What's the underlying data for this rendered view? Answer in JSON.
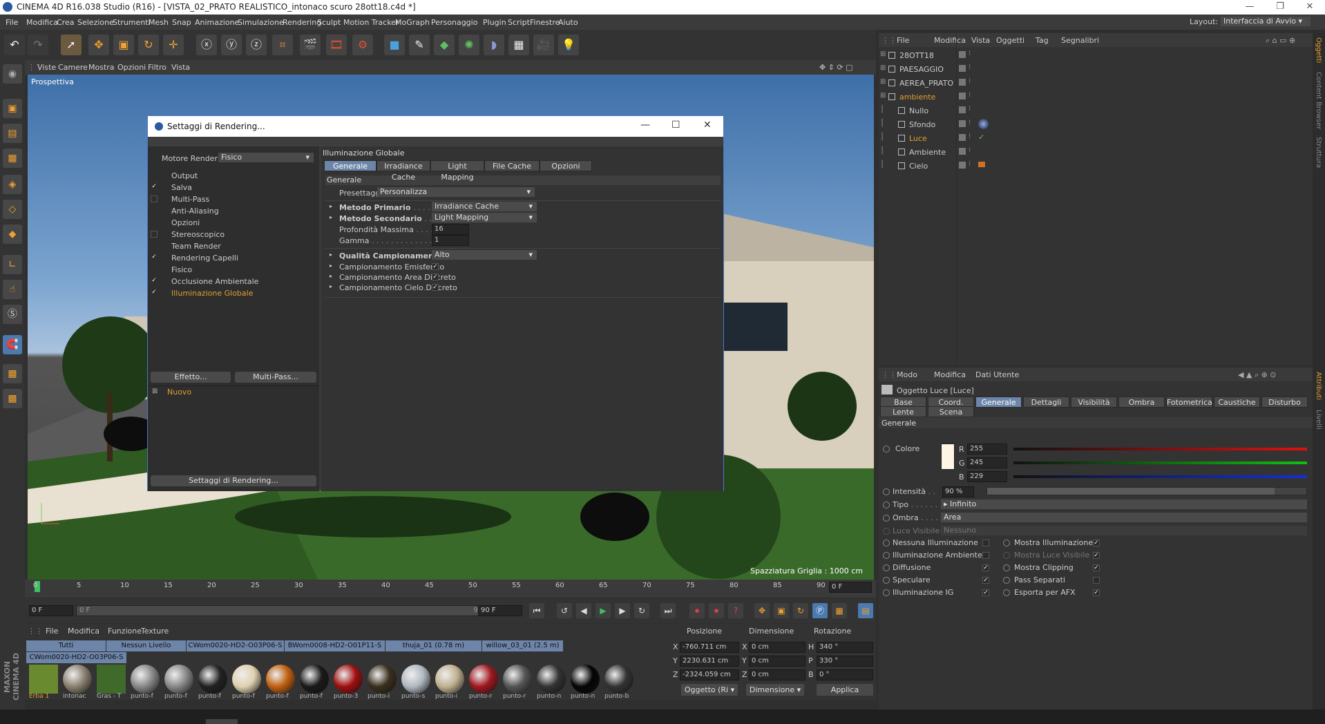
{
  "app": {
    "title": "CINEMA 4D R16.038 Studio (R16) - [VISTA_02_PRATO REALISTICO_intonaco scuro 28ott18.c4d *]"
  },
  "window_controls": {
    "minimize": "—",
    "maximize": "❐",
    "close": "✕"
  },
  "menubar": [
    "File",
    "Modifica",
    "Crea",
    "Selezione",
    "Strumenti",
    "Mesh",
    "Snap",
    "Animazione",
    "Simulazione",
    "Rendering",
    "Sculpt",
    "Motion Tracker",
    "MoGraph",
    "Personaggio",
    "Plugin",
    "Script",
    "Finestre",
    "Aiuto"
  ],
  "layout": {
    "label": "Layout:",
    "value": "Interfaccia di Avvio"
  },
  "viewport": {
    "menu": [
      "Viste",
      "Camere",
      "Mostra",
      "Opzioni",
      "Filtro",
      "Vista"
    ],
    "label": "Prospettiva",
    "grid_info": "Spazziatura Griglia : 1000 cm"
  },
  "timeline": {
    "ticks": [
      "0",
      "5",
      "10",
      "15",
      "20",
      "25",
      "30",
      "35",
      "40",
      "45",
      "50",
      "55",
      "60",
      "65",
      "70",
      "75",
      "80",
      "85",
      "90"
    ],
    "end_field": "0 F"
  },
  "transport": {
    "start": "0 F",
    "range_start": "0 F",
    "range_end": "90 F",
    "end": "90 F"
  },
  "materials": {
    "menu": [
      "File",
      "Modifica",
      "Funzione",
      "Texture"
    ],
    "tabs": [
      "Tutti",
      "Nessun Livello",
      "CWom0020-HD2-O03P06-S",
      "BWom0008-HD2-O01P11-S",
      "thuja_01 (0.78 m)",
      "willow_03_01 (2.5 m)"
    ],
    "tab2": "CWom0020-HD2-O03P06-S",
    "items": [
      {
        "name": "Erba 1",
        "color": "#6a8a30"
      },
      {
        "name": "intonac",
        "color": "#8a8070"
      },
      {
        "name": "Gras - T",
        "color": "#3f6a2a"
      },
      {
        "name": "punto-f",
        "color": "#888"
      },
      {
        "name": "punto-f",
        "color": "#888"
      },
      {
        "name": "punto-f",
        "color": "#222"
      },
      {
        "name": "punto-f",
        "color": "#e0d0b0"
      },
      {
        "name": "punto-f",
        "color": "#c06010"
      },
      {
        "name": "punto-f",
        "color": "#1a1a1a"
      },
      {
        "name": "punto-3",
        "color": "#a01010"
      },
      {
        "name": "punto-i",
        "color": "#3a3020"
      },
      {
        "name": "punto-s",
        "color": "#b0b8c0"
      },
      {
        "name": "punto-i",
        "color": "#c0b090"
      },
      {
        "name": "punto-r",
        "color": "#a01820"
      },
      {
        "name": "punto-r",
        "color": "#555"
      },
      {
        "name": "punto-n",
        "color": "#333"
      },
      {
        "name": "punto-n",
        "color": "#050505"
      },
      {
        "name": "punto-b",
        "color": "#333"
      }
    ]
  },
  "coords": {
    "headers": [
      "Posizione",
      "Dimensione",
      "Rotazione"
    ],
    "rows": [
      {
        "a": "X",
        "pos": "-760.711 cm",
        "b": "X",
        "dim": "0 cm",
        "c": "H",
        "rot": "340 °"
      },
      {
        "a": "Y",
        "pos": "2230.631 cm",
        "b": "Y",
        "dim": "0 cm",
        "c": "P",
        "rot": "330 °"
      },
      {
        "a": "Z",
        "pos": "-2324.059 cm",
        "b": "Z",
        "dim": "0 cm",
        "c": "B",
        "rot": "0 °"
      }
    ],
    "mode": "Oggetto (Ri",
    "dim_mode": "Dimensione",
    "apply": "Applica"
  },
  "objects": {
    "menu": [
      "File",
      "Modifica",
      "Vista",
      "Oggetti",
      "Tag",
      "Segnalibri"
    ],
    "items": [
      {
        "name": "28OTT18",
        "indent": 0,
        "active": false
      },
      {
        "name": "PAESAGGIO",
        "indent": 0,
        "active": false
      },
      {
        "name": "AEREA_PRATO",
        "indent": 0,
        "active": false
      },
      {
        "name": "ambiente",
        "indent": 0,
        "active": true
      },
      {
        "name": "Nullo",
        "indent": 1,
        "active": false
      },
      {
        "name": "Sfondo",
        "indent": 1,
        "active": false
      },
      {
        "name": "Luce",
        "indent": 1,
        "active": true
      },
      {
        "name": "Ambiente",
        "indent": 1,
        "active": false
      },
      {
        "name": "Cielo",
        "indent": 1,
        "active": false
      }
    ]
  },
  "attributes": {
    "menu": [
      "Modo",
      "Modifica",
      "Dati Utente"
    ],
    "object_title": "Oggetto Luce [Luce]",
    "tabs": [
      "Base",
      "Coord.",
      "Generale",
      "Dettagli",
      "Visibilità",
      "Ombra",
      "Fotometrica",
      "Caustiche",
      "Disturbo"
    ],
    "tabs2": [
      "Lente",
      "Scena"
    ],
    "section": "Generale",
    "color_label": "Colore",
    "r_label": "R",
    "g_label": "G",
    "b_label": "B",
    "r": "255",
    "g": "245",
    "b": "229",
    "intensity_label": "Intensità",
    "intensity": "90 %",
    "intensity_value": 0.9,
    "tipo_label": "Tipo",
    "tipo": "Infinito",
    "ombra_label": "Ombra",
    "ombra": "Area",
    "luce_visibile_label": "Luce Visibile",
    "luce_visibile": "Nessuno",
    "left_checks": [
      {
        "label": "Nessuna Illuminazione",
        "checked": false
      },
      {
        "label": "Illuminazione Ambiente",
        "checked": false
      },
      {
        "label": "Diffusione",
        "checked": true
      },
      {
        "label": "Speculare",
        "checked": true
      },
      {
        "label": "Illuminazione IG",
        "checked": true
      }
    ],
    "right_checks": [
      {
        "label": "Mostra Illuminazione",
        "checked": true
      },
      {
        "label": "Mostra Luce Visibile",
        "checked": true
      },
      {
        "label": "Mostra Clipping",
        "checked": true
      },
      {
        "label": "Pass Separati",
        "checked": false
      },
      {
        "label": "Esporta per AFX",
        "checked": true
      }
    ]
  },
  "side_tabs": [
    "Oggetti",
    "Content Browser",
    "Struttura"
  ],
  "side_tabs2": [
    "Attributi",
    "Livelli"
  ],
  "dialog": {
    "title": "Settaggi di Rendering...",
    "engine_label": "Motore Render",
    "engine": "Fisico",
    "items": [
      {
        "label": "Output",
        "check": "none",
        "active": false
      },
      {
        "label": "Salva",
        "check": "yes",
        "active": false
      },
      {
        "label": "Multi-Pass",
        "check": "no",
        "active": false
      },
      {
        "label": "Anti-Aliasing",
        "check": "none",
        "active": false
      },
      {
        "label": "Opzioni",
        "check": "none",
        "active": false
      },
      {
        "label": "Stereoscopico",
        "check": "no",
        "active": false
      },
      {
        "label": "Team Render",
        "check": "none",
        "active": false
      },
      {
        "label": "Rendering Capelli",
        "check": "yes",
        "active": false
      },
      {
        "label": "Fisico",
        "check": "none",
        "active": false
      },
      {
        "label": "Occlusione Ambientale",
        "check": "yes",
        "active": false
      },
      {
        "label": "Illuminazione Globale",
        "check": "yes",
        "active": true
      }
    ],
    "effect_btn": "Effetto...",
    "multipass_btn": "Multi-Pass...",
    "new_item": "Nuovo",
    "settings_btn": "Settaggi di Rendering...",
    "panel_title": "Illuminazione Globale",
    "tabs": [
      "Generale",
      "Irradiance Cache",
      "Light Mapping",
      "File Cache",
      "Opzioni"
    ],
    "section": "Generale",
    "preset_label": "Presettaggi",
    "preset": "Personalizza",
    "primary_label": "Metodo Primario",
    "primary": "Irradiance Cache",
    "secondary_label": "Metodo Secondario",
    "secondary": "Light Mapping",
    "depth_label": "Profondità Massima",
    "depth": "16",
    "gamma_label": "Gamma",
    "gamma": "1",
    "quality_label": "Qualità Campionamento",
    "quality": "Alto",
    "samp": [
      {
        "label": "Campionamento Emisferico",
        "checked": true
      },
      {
        "label": "Campionamento Area Discreto",
        "checked": true
      },
      {
        "label": "Campionamento Cielo Discreto",
        "checked": true
      }
    ]
  }
}
